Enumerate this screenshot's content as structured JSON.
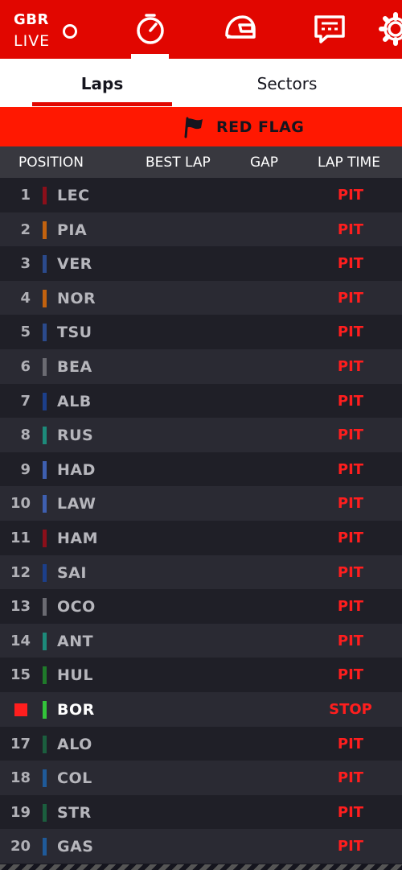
{
  "header": {
    "circuit": "GBR",
    "session": "LIVE",
    "nav": [
      "timing-icon",
      "helmet-icon",
      "race-control-icon",
      "settings-icon"
    ]
  },
  "tabs": [
    {
      "label": "Laps",
      "active": true
    },
    {
      "label": "Sectors",
      "active": false
    }
  ],
  "status": {
    "label": "RED FLAG",
    "color": "#ff1801"
  },
  "table": {
    "headers": {
      "position": "POSITION",
      "best_lap": "BEST LAP",
      "gap": "GAP",
      "lap_time": "LAP TIME"
    },
    "rows": [
      {
        "pos": "1",
        "code": "LEC",
        "team_color": "#8b0f1a",
        "lap_time": "PIT"
      },
      {
        "pos": "2",
        "code": "PIA",
        "team_color": "#c2620f",
        "lap_time": "PIT"
      },
      {
        "pos": "3",
        "code": "VER",
        "team_color": "#2b4a8c",
        "lap_time": "PIT"
      },
      {
        "pos": "4",
        "code": "NOR",
        "team_color": "#c2620f",
        "lap_time": "PIT"
      },
      {
        "pos": "5",
        "code": "TSU",
        "team_color": "#2b4a8c",
        "lap_time": "PIT"
      },
      {
        "pos": "6",
        "code": "BEA",
        "team_color": "#6b6b72",
        "lap_time": "PIT"
      },
      {
        "pos": "7",
        "code": "ALB",
        "team_color": "#1c3f8a",
        "lap_time": "PIT"
      },
      {
        "pos": "8",
        "code": "RUS",
        "team_color": "#1d8a7a",
        "lap_time": "PIT"
      },
      {
        "pos": "9",
        "code": "HAD",
        "team_color": "#3e5fb0",
        "lap_time": "PIT"
      },
      {
        "pos": "10",
        "code": "LAW",
        "team_color": "#3e5fb0",
        "lap_time": "PIT"
      },
      {
        "pos": "11",
        "code": "HAM",
        "team_color": "#8b0f1a",
        "lap_time": "PIT"
      },
      {
        "pos": "12",
        "code": "SAI",
        "team_color": "#1c3f8a",
        "lap_time": "PIT"
      },
      {
        "pos": "13",
        "code": "OCO",
        "team_color": "#6b6b72",
        "lap_time": "PIT"
      },
      {
        "pos": "14",
        "code": "ANT",
        "team_color": "#1d8a7a",
        "lap_time": "PIT"
      },
      {
        "pos": "15",
        "code": "HUL",
        "team_color": "#1f7a2a",
        "lap_time": "PIT"
      },
      {
        "pos": "",
        "code": "BOR",
        "team_color": "#33c43a",
        "lap_time": "STOP",
        "retired": true
      },
      {
        "pos": "17",
        "code": "ALO",
        "team_color": "#1b5e3e",
        "lap_time": "PIT"
      },
      {
        "pos": "18",
        "code": "COL",
        "team_color": "#1f5a99",
        "lap_time": "PIT"
      },
      {
        "pos": "19",
        "code": "STR",
        "team_color": "#1b5e3e",
        "lap_time": "PIT"
      },
      {
        "pos": "20",
        "code": "GAS",
        "team_color": "#1f5a99",
        "lap_time": "PIT"
      }
    ]
  }
}
